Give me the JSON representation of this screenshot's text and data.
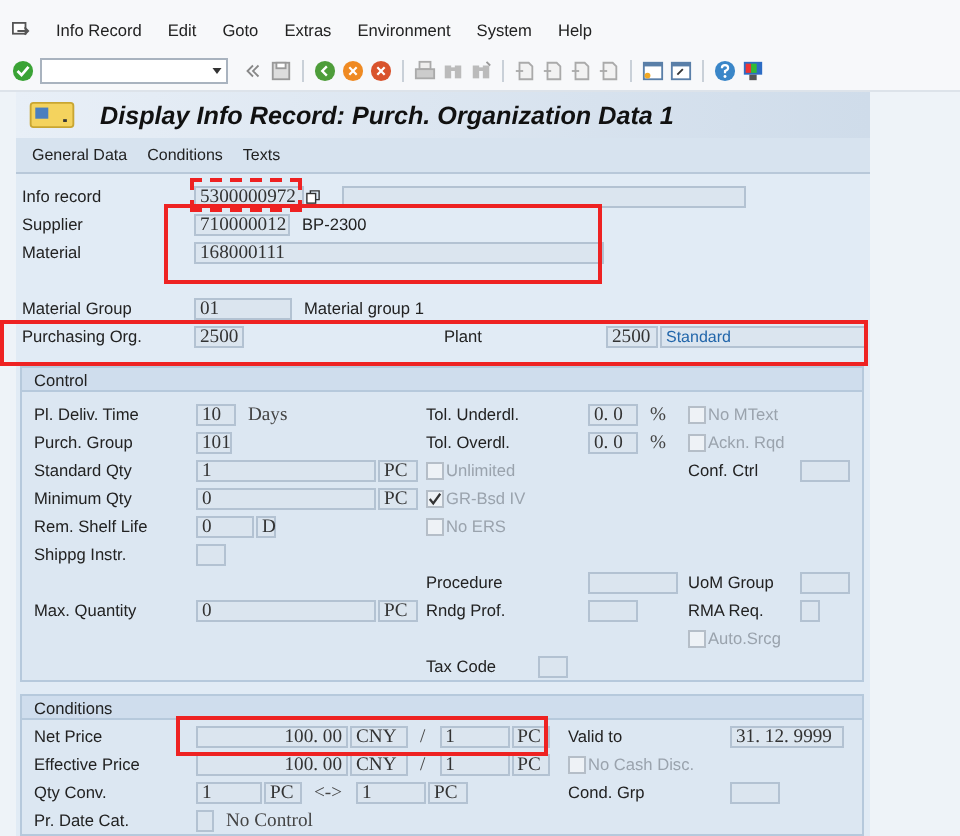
{
  "menu": [
    {
      "label": "Info Record"
    },
    {
      "label": "Edit"
    },
    {
      "label": "Goto"
    },
    {
      "label": "Extras"
    },
    {
      "label": "Environment"
    },
    {
      "label": "System"
    },
    {
      "label": "Help"
    }
  ],
  "title": "Display Info Record: Purch. Organization Data 1",
  "app_buttons": [
    {
      "label": "General Data"
    },
    {
      "label": "Conditions"
    },
    {
      "label": "Texts"
    }
  ],
  "header_rows": [
    {
      "left": [
        {
          "kind": "label",
          "text": "Info record"
        },
        {
          "kind": "field",
          "value": "5300000972"
        },
        {
          "kind": "field"
        }
      ]
    },
    {
      "left": [
        {
          "kind": "label",
          "text": "Supplier"
        },
        {
          "kind": "field",
          "value": "710000012"
        },
        {
          "kind": "text",
          "text": "BP-2300"
        }
      ]
    },
    {
      "left": [
        {
          "kind": "label",
          "text": "Material"
        },
        {
          "kind": "field",
          "value": "168000111"
        }
      ]
    },
    {
      "left": [
        {
          "kind": "label",
          "text": "Material Group"
        },
        {
          "kind": "field",
          "value": "01"
        },
        {
          "kind": "text",
          "text": "Material group 1"
        }
      ]
    },
    {
      "left": [
        {
          "kind": "label",
          "text": "Purchasing Org."
        },
        {
          "kind": "field",
          "value": "2500"
        }
      ],
      "middle": [
        {
          "kind": "label",
          "text": "Plant"
        },
        {
          "kind": "field",
          "value": "2500"
        },
        {
          "kind": "field",
          "value": "Standard"
        }
      ]
    }
  ],
  "control": {
    "title": "Control",
    "rows": [
      {
        "left": [
          {
            "kind": "label",
            "text": "Pl. Deliv. Time"
          },
          {
            "kind": "field",
            "value": "10"
          },
          {
            "kind": "text",
            "text": "Days"
          }
        ],
        "middle": [
          {
            "kind": "label",
            "text": "Tol. Underdl."
          },
          {
            "kind": "field",
            "value": "0. 0"
          },
          {
            "kind": "text",
            "text": "%"
          }
        ],
        "right": [
          {
            "kind": "checkbox",
            "label": "No MText",
            "checked": false,
            "disabled": true
          }
        ]
      },
      {
        "left": [
          {
            "kind": "label",
            "text": "Purch. Group"
          },
          {
            "kind": "field",
            "value": "101"
          }
        ],
        "middle": [
          {
            "kind": "label",
            "text": "Tol. Overdl."
          },
          {
            "kind": "field",
            "value": "0. 0"
          },
          {
            "kind": "text",
            "text": "%"
          }
        ],
        "right": [
          {
            "kind": "checkbox",
            "label": "Ackn. Rqd",
            "checked": false,
            "disabled": true
          }
        ]
      },
      {
        "left": [
          {
            "kind": "label",
            "text": "Standard Qty"
          },
          {
            "kind": "field",
            "value": "1"
          },
          {
            "kind": "field",
            "value": "PC"
          }
        ],
        "middle": [
          {
            "kind": "checkbox",
            "label": "Unlimited",
            "checked": false,
            "disabled": true
          }
        ],
        "right": [
          {
            "kind": "label",
            "text": "Conf. Ctrl"
          },
          {
            "kind": "field"
          }
        ]
      },
      {
        "left": [
          {
            "kind": "label",
            "text": "Minimum Qty"
          },
          {
            "kind": "field",
            "value": "0"
          },
          {
            "kind": "field",
            "value": "PC"
          }
        ],
        "middle": [
          {
            "kind": "checkbox",
            "label": "GR-Bsd IV",
            "checked": true,
            "disabled": true
          }
        ]
      },
      {
        "left": [
          {
            "kind": "label",
            "text": "Rem. Shelf Life"
          },
          {
            "kind": "field",
            "value": "0"
          },
          {
            "kind": "field",
            "value": "D"
          }
        ],
        "middle": [
          {
            "kind": "checkbox",
            "label": "No ERS",
            "checked": false,
            "disabled": true
          }
        ]
      },
      {
        "left": [
          {
            "kind": "label",
            "text": "Shippg Instr."
          },
          {
            "kind": "field"
          }
        ]
      },
      {
        "middle": [
          {
            "kind": "label",
            "text": "Procedure"
          },
          {
            "kind": "field"
          }
        ],
        "right": [
          {
            "kind": "label",
            "text": "UoM Group"
          },
          {
            "kind": "field"
          }
        ]
      },
      {
        "left": [
          {
            "kind": "label",
            "text": "Max. Quantity"
          },
          {
            "kind": "field",
            "value": "0"
          },
          {
            "kind": "field",
            "value": "PC"
          }
        ],
        "middle": [
          {
            "kind": "label",
            "text": "Rndg Prof."
          },
          {
            "kind": "field"
          }
        ],
        "right": [
          {
            "kind": "label",
            "text": "RMA Req."
          },
          {
            "kind": "field"
          }
        ]
      },
      {
        "right": [
          {
            "kind": "checkbox",
            "label": "Auto.Srcg",
            "checked": false,
            "disabled": true
          }
        ]
      },
      {
        "middle": [
          {
            "kind": "label",
            "text": "Tax Code"
          },
          {
            "kind": "field"
          }
        ]
      }
    ]
  },
  "conditions": {
    "title": "Conditions",
    "rows": [
      {
        "left": [
          {
            "kind": "label",
            "text": "Net Price"
          },
          {
            "kind": "field",
            "value": "100. 00"
          },
          {
            "kind": "field",
            "value": "CNY"
          },
          {
            "kind": "text",
            "text": "/"
          },
          {
            "kind": "field",
            "value": "1"
          },
          {
            "kind": "field",
            "value": "PC"
          }
        ],
        "right": [
          {
            "kind": "label",
            "text": "Valid to"
          },
          {
            "kind": "field",
            "value": "31. 12. 9999"
          }
        ]
      },
      {
        "left": [
          {
            "kind": "label",
            "text": "Effective Price"
          },
          {
            "kind": "field",
            "value": "100. 00"
          },
          {
            "kind": "field",
            "value": "CNY"
          },
          {
            "kind": "text",
            "text": "/"
          },
          {
            "kind": "field",
            "value": "1"
          },
          {
            "kind": "field",
            "value": "PC"
          }
        ],
        "right": [
          {
            "kind": "checkbox",
            "label": "No Cash Disc.",
            "checked": false,
            "disabled": true
          }
        ]
      },
      {
        "left": [
          {
            "kind": "label",
            "text": "Qty Conv."
          },
          {
            "kind": "field",
            "value": "1"
          },
          {
            "kind": "field",
            "value": "PC"
          },
          {
            "kind": "text",
            "text": "<->"
          },
          {
            "kind": "field",
            "value": "1"
          },
          {
            "kind": "field",
            "value": "PC"
          }
        ],
        "right": [
          {
            "kind": "label",
            "text": "Cond. Grp"
          },
          {
            "kind": "field"
          }
        ]
      },
      {
        "left": [
          {
            "kind": "label",
            "text": "Pr. Date Cat."
          },
          {
            "kind": "field"
          },
          {
            "kind": "text",
            "text": "No Control"
          }
        ]
      }
    ]
  },
  "annotation_frames": [
    {
      "kind": "frame"
    },
    {
      "kind": "frame"
    },
    {
      "kind": "frame"
    },
    {
      "kind": "frame"
    }
  ]
}
